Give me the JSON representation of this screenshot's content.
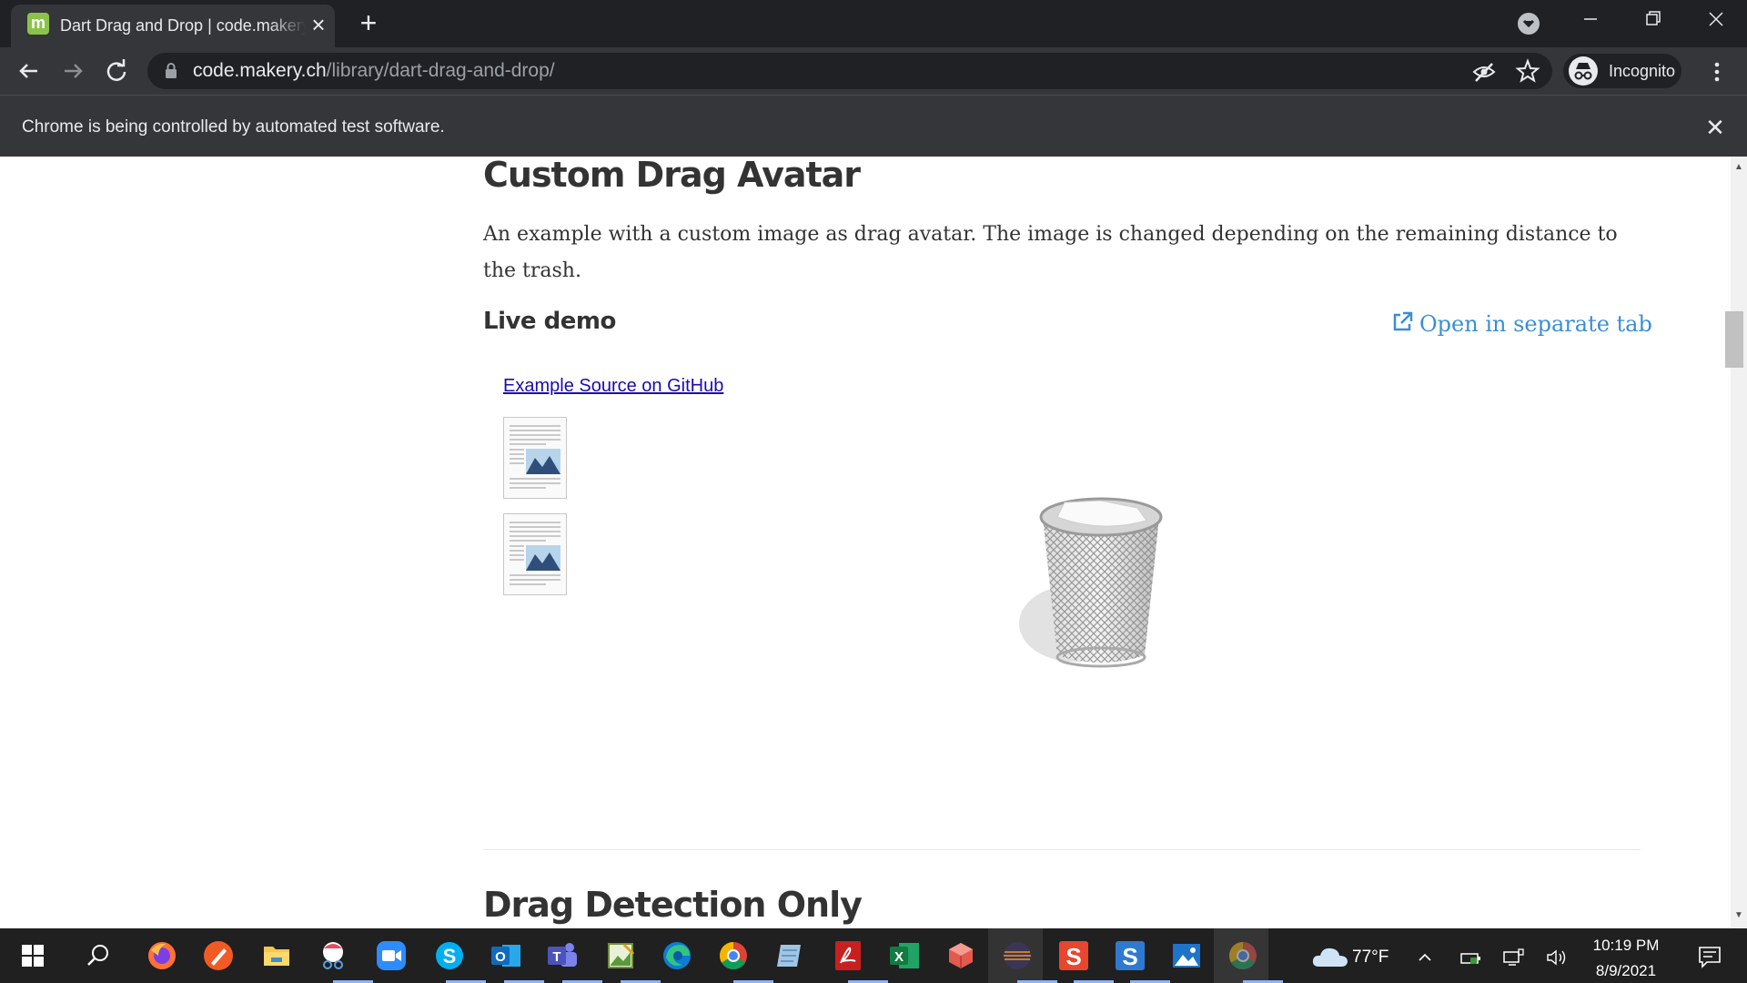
{
  "browser": {
    "tab_title": "Dart Drag and Drop | code.makery.ch",
    "tab_favicon_letter": "m",
    "url_host": "code.makery.ch",
    "url_path": "/library/dart-drag-and-drop/",
    "profile_label": "Incognito",
    "infobar_text": "Chrome is being controlled by automated test software."
  },
  "page": {
    "heading_custom": "Custom Drag Avatar",
    "intro": "An example with a custom image as drag avatar. The image is changed depending on the remaining distance to the trash.",
    "live_demo": "Live demo",
    "open_tab": "Open in separate tab",
    "github_link": "Example Source on GitHub",
    "heading_next": "Drag Detection Only"
  },
  "taskbar": {
    "apps": [
      "start",
      "search",
      "firefox",
      "paint-tool",
      "file-explorer",
      "snipping-tool",
      "zoom",
      "skype",
      "outlook",
      "teams",
      "image-editor",
      "edge",
      "chrome",
      "notes",
      "acrobat",
      "excel",
      "3d-builder",
      "eclipse",
      "sublime-s",
      "sublime-s-blue",
      "photos",
      "chrome-active"
    ],
    "temperature": "77°F",
    "time": "10:19 PM",
    "date": "8/9/2021"
  },
  "colors": {
    "titlebar": "#202124",
    "toolbar": "#35363a",
    "link": "#1a0dab",
    "accent_link": "#3b8ed6",
    "taskbar": "#202020"
  }
}
